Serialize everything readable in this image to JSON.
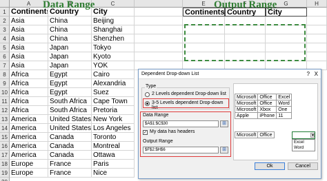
{
  "labels": {
    "data_range": "Data Range",
    "output_range": "Output Range"
  },
  "columns": {
    "left": [
      "A",
      "B",
      "C"
    ],
    "right": [
      "E",
      "F",
      "G",
      "H"
    ]
  },
  "rows": [
    "1",
    "2",
    "3",
    "4",
    "5",
    "6",
    "7",
    "8",
    "9",
    "10",
    "11",
    "12",
    "13",
    "14",
    "15",
    "16",
    "17",
    "18",
    "19",
    "20"
  ],
  "table": {
    "headers": [
      "Continents",
      "Country",
      "City"
    ],
    "rows": [
      [
        "Asia",
        "China",
        "Beijing"
      ],
      [
        "Asia",
        "China",
        "Shanghai"
      ],
      [
        "Asia",
        "China",
        "Shenzhen"
      ],
      [
        "Asia",
        "Japan",
        "Tokyo"
      ],
      [
        "Asia",
        "Japan",
        "Kyoto"
      ],
      [
        "Asia",
        "Japan",
        "YOK"
      ],
      [
        "Africa",
        "Egypt",
        "Cairo"
      ],
      [
        "Africa",
        "Egypt",
        "Alexandria"
      ],
      [
        "Africa",
        "Egypt",
        "Suez"
      ],
      [
        "Africa",
        "South Africa",
        "Cape Town"
      ],
      [
        "Africa",
        "South Africa",
        "Pretoria"
      ],
      [
        "America",
        "United States",
        "New York"
      ],
      [
        "America",
        "United States",
        "Los Angeles"
      ],
      [
        "America",
        "Canada",
        "Toronto"
      ],
      [
        "America",
        "Canada",
        "Montreal"
      ],
      [
        "America",
        "Canada",
        "Ottawa"
      ],
      [
        "Europe",
        "France",
        "Paris"
      ],
      [
        "Europe",
        "France",
        "Nice"
      ]
    ]
  },
  "output_headers": [
    "Continents",
    "Country",
    "City"
  ],
  "dialog": {
    "title": "Dependent Drop-down List",
    "help": "?",
    "close": "X",
    "type_label": "Type",
    "option_2": "2 Levels dependent Drop-down list",
    "option_3": "3-5 Levels dependent Drop-down list",
    "data_range_label": "Data Range",
    "data_range_value": "$A$1:$C$30",
    "headers_checkbox": "My data has headers",
    "output_range_label": "Output Range",
    "output_range_value": "$F$2:$H$6",
    "ok": "Ok",
    "cancel": "Cancel"
  },
  "illustration": {
    "rows": [
      [
        "Microsoft",
        "Office",
        "Excel"
      ],
      [
        "Microsoft",
        "Office",
        "Word"
      ],
      [
        "Microsoft",
        "Xbox",
        "One"
      ],
      [
        "Apple",
        "iPhone",
        "11"
      ]
    ],
    "selected": [
      "Microsoft",
      "Office"
    ],
    "dropdown": [
      "Excel",
      "Word"
    ]
  },
  "colors": {
    "accent_green": "#2f7d32",
    "highlight_red": "#e03b3b"
  }
}
